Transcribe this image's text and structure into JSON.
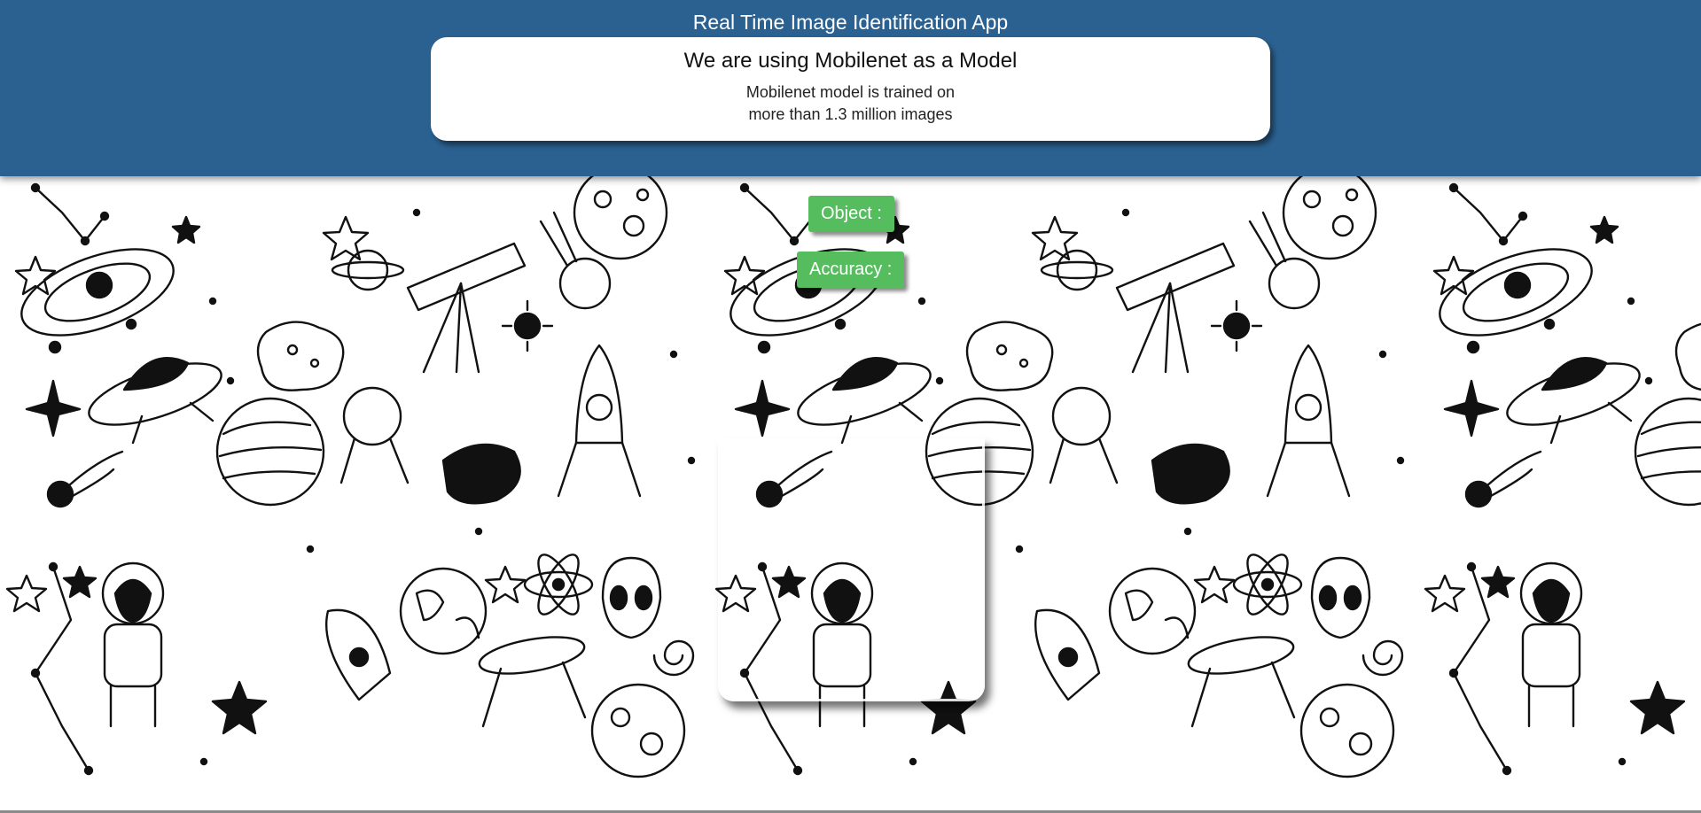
{
  "header": {
    "title": "Real Time Image Identification App",
    "background_color": "#2b6190"
  },
  "model_card": {
    "heading": "We are using Mobilenet as a Model",
    "description_line1": "Mobilenet model is trained on",
    "description_line2": "more than 1.3 million images"
  },
  "results": {
    "object_label": "Object :",
    "accuracy_label": "Accuracy :",
    "label_color": "#56bd5f"
  },
  "background": {
    "pattern": "space-doodles",
    "icons": [
      "astronaut-icon",
      "rocket-icon",
      "planet-icon",
      "ufo-icon",
      "telescope-icon",
      "alien-icon",
      "star-icon",
      "comet-icon",
      "atom-icon",
      "earth-icon",
      "moon-icon",
      "satellite-icon",
      "asteroid-icon",
      "constellation-icon",
      "galaxy-icon"
    ]
  }
}
